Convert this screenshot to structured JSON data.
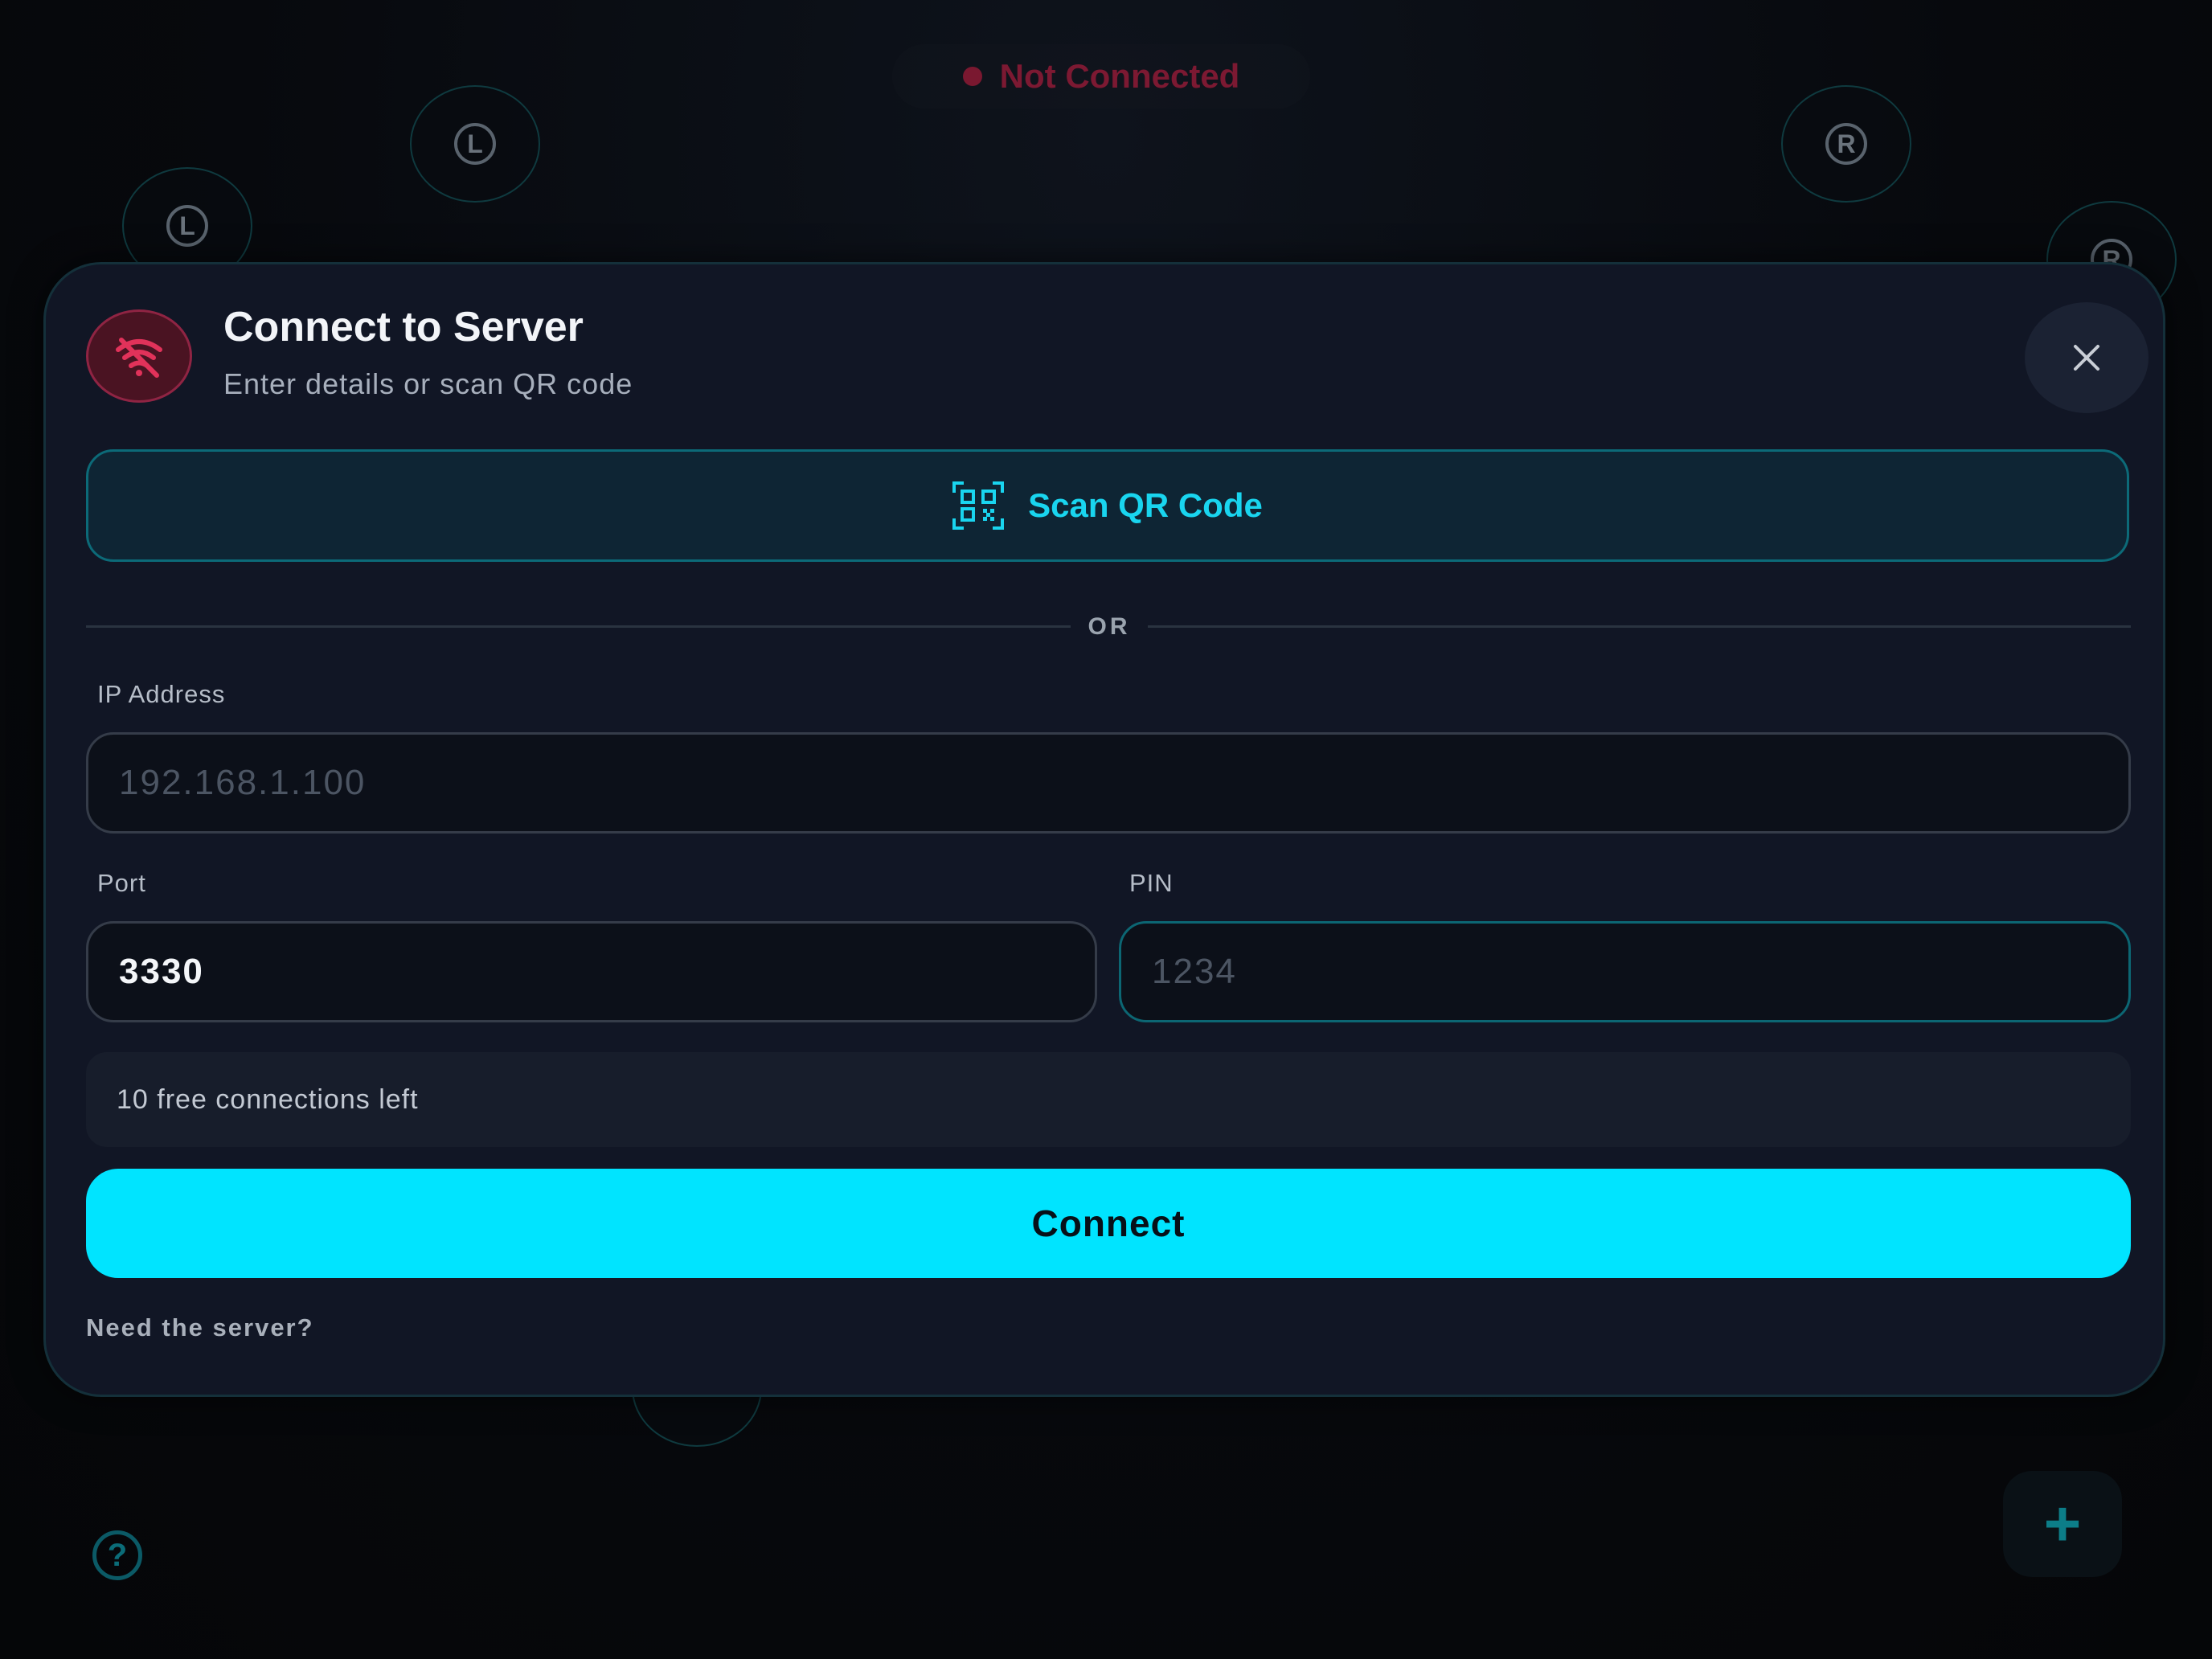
{
  "status": {
    "text": "Not Connected",
    "color": "#7c1932"
  },
  "background_buttons": [
    {
      "label": "L"
    },
    {
      "label": "L"
    },
    {
      "label": "R"
    },
    {
      "label": "R"
    }
  ],
  "dialog": {
    "title": "Connect to Server",
    "subtitle": "Enter details or scan QR code",
    "header_icon": "wifi-off-icon",
    "close_icon": "close-icon",
    "scan_button": {
      "label": "Scan QR Code",
      "icon": "qr-code-icon"
    },
    "divider_text": "OR",
    "ip": {
      "label": "IP Address",
      "value": "",
      "placeholder": "192.168.1.100"
    },
    "port": {
      "label": "Port",
      "value": "3330",
      "placeholder": ""
    },
    "pin": {
      "label": "PIN",
      "value": "",
      "placeholder": "1234"
    },
    "free_connections": "10 free connections left",
    "connect_label": "Connect",
    "need_server": "Need the server?"
  },
  "bottom": {
    "help_icon": "help-icon",
    "help_glyph": "?",
    "add_icon": "plus-icon",
    "add_glyph": "+"
  },
  "colors": {
    "accent": "#00e4ff",
    "error": "#e1325a",
    "panel": "#111625"
  }
}
